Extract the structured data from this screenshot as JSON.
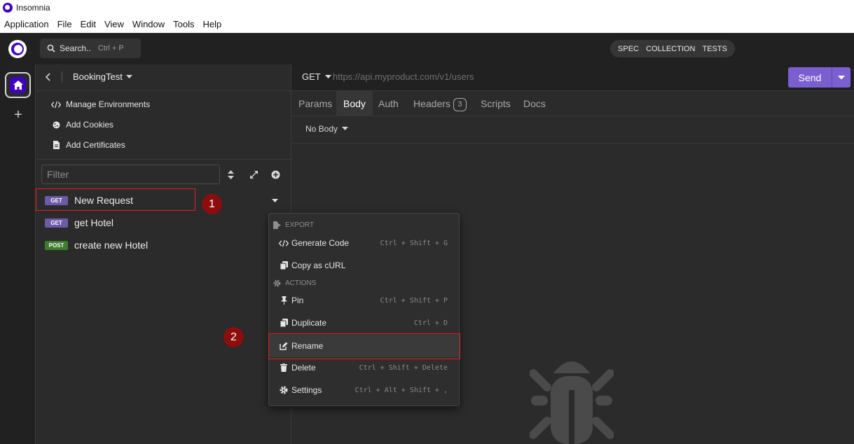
{
  "window": {
    "title": "Insomnia"
  },
  "menubar": [
    "Application",
    "File",
    "Edit",
    "View",
    "Window",
    "Tools",
    "Help"
  ],
  "header": {
    "search_label": "Search..",
    "search_shortcut": "Ctrl + P",
    "tabs": [
      "SPEC",
      "COLLECTION",
      "TESTS"
    ]
  },
  "sidebar": {
    "workspace": "BookingTest",
    "links": [
      {
        "label": "Manage Environments",
        "icon": "code-icon"
      },
      {
        "label": "Add Cookies",
        "icon": "cookie-icon"
      },
      {
        "label": "Add Certificates",
        "icon": "certificate-icon"
      }
    ],
    "filter_placeholder": "Filter",
    "requests": [
      {
        "method": "GET",
        "name": "New Request"
      },
      {
        "method": "GET",
        "name": "get Hotel"
      },
      {
        "method": "POST",
        "name": "create new Hotel"
      }
    ]
  },
  "request": {
    "method": "GET",
    "url_placeholder": "https://api.myproduct.com/v1/users",
    "send_label": "Send",
    "tabs": [
      {
        "label": "Params"
      },
      {
        "label": "Body",
        "active": true
      },
      {
        "label": "Auth"
      },
      {
        "label": "Headers",
        "count": "3"
      },
      {
        "label": "Scripts"
      },
      {
        "label": "Docs"
      }
    ],
    "body_type": "No Body"
  },
  "context_menu": {
    "export_header": "EXPORT",
    "actions_header": "ACTIONS",
    "items": [
      {
        "label": "Generate Code",
        "shortcut": "Ctrl + Shift + G",
        "icon": "code-icon"
      },
      {
        "label": "Copy as cURL",
        "shortcut": "",
        "icon": "copy-icon"
      },
      {
        "label": "Pin",
        "shortcut": "Ctrl + Shift + P",
        "icon": "pin-icon"
      },
      {
        "label": "Duplicate",
        "shortcut": "Ctrl + D",
        "icon": "duplicate-icon"
      },
      {
        "label": "Rename",
        "shortcut": "",
        "icon": "edit-icon"
      },
      {
        "label": "Delete",
        "shortcut": "Ctrl + Shift + Delete",
        "icon": "trash-icon"
      },
      {
        "label": "Settings",
        "shortcut": "Ctrl + Alt + Shift + ,",
        "icon": "gear-icon"
      }
    ]
  },
  "annotations": {
    "step1": "1",
    "step2": "2"
  },
  "colors": {
    "accent": "#4000bf",
    "send": "#7b5fd1",
    "get_badge": "#6d5ba8",
    "post_badge": "#3e7d2c",
    "annotation_red": "#e02020",
    "annotation_dot": "#8b0d0d"
  }
}
